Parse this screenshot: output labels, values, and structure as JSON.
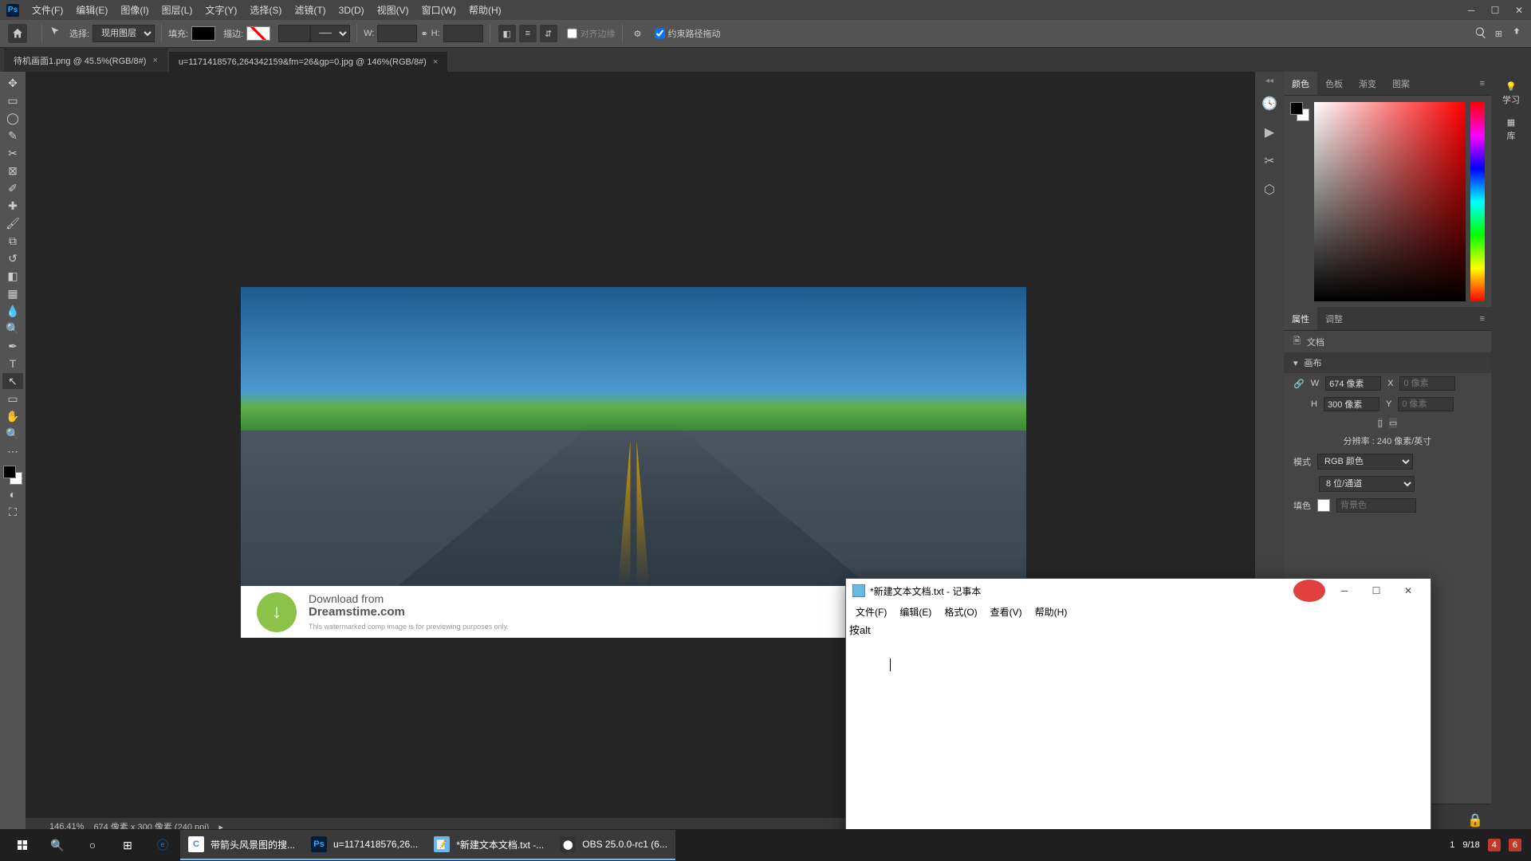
{
  "menubar": {
    "items": [
      "文件(F)",
      "编辑(E)",
      "图像(I)",
      "图层(L)",
      "文字(Y)",
      "选择(S)",
      "滤镜(T)",
      "3D(D)",
      "视图(V)",
      "窗口(W)",
      "帮助(H)"
    ]
  },
  "optionbar": {
    "select_label": "选择:",
    "select_value": "现用图层",
    "fill_label": "填充:",
    "stroke_label": "描边:",
    "w_label": "W:",
    "h_label": "H:",
    "align_label": "对齐边缘",
    "constrain_label": "约束路径拖动"
  },
  "tabs": [
    {
      "label": "待机画面1.png @ 45.5%(RGB/8#)"
    },
    {
      "label": "u=1171418576,264342159&fm=26&gp=0.jpg @ 146%(RGB/8#)"
    }
  ],
  "download": {
    "line1": "Download from",
    "line2": "Dreamstime.com",
    "note": "This watermarked comp image is for previewing purposes only."
  },
  "panels": {
    "color_tabs": [
      "颜色",
      "色板",
      "渐变",
      "图案"
    ],
    "props_tabs": [
      "属性",
      "调整"
    ],
    "doc_label": "文档",
    "canvas_label": "画布",
    "w_label": "W",
    "w_value": "674 像素",
    "x_label": "X",
    "x_ph": "0 像素",
    "h_label": "H",
    "h_value": "300 像素",
    "y_label": "Y",
    "y_ph": "0 像素",
    "res_label": "分辨率 : 240 像素/英寸",
    "mode_label": "模式",
    "mode_value": "RGB 颜色",
    "depth_value": "8 位/通道",
    "fill_label": "填色",
    "fill_ph": "背景色"
  },
  "right_strip": {
    "learn": "学习",
    "lib": "库"
  },
  "status": {
    "zoom": "146.41%",
    "dims": "674 像素 x 300 像素 (240 ppi)"
  },
  "notepad": {
    "title": "*新建文本文档.txt - 记事本",
    "menu": [
      "文件(F)",
      "编辑(E)",
      "格式(O)",
      "查看(V)",
      "帮助(H)"
    ],
    "content": "按alt"
  },
  "taskbar": {
    "apps": [
      {
        "label": "带箭头风景图的搜...",
        "icon": "C",
        "bg": "#fff",
        "color": "#4285f4"
      },
      {
        "label": "u=1171418576,26...",
        "icon": "Ps",
        "bg": "#001e36",
        "color": "#31a8ff"
      },
      {
        "label": "*新建文本文档.txt -...",
        "icon": "",
        "bg": "#6bb8e8",
        "color": "#fff"
      },
      {
        "label": "OBS 25.0.0-rc1 (6...",
        "icon": "",
        "bg": "#333",
        "color": "#fff"
      }
    ],
    "tray": {
      "count1": "1",
      "date": "9/18",
      "badge1": "4",
      "badge2": "6"
    }
  }
}
